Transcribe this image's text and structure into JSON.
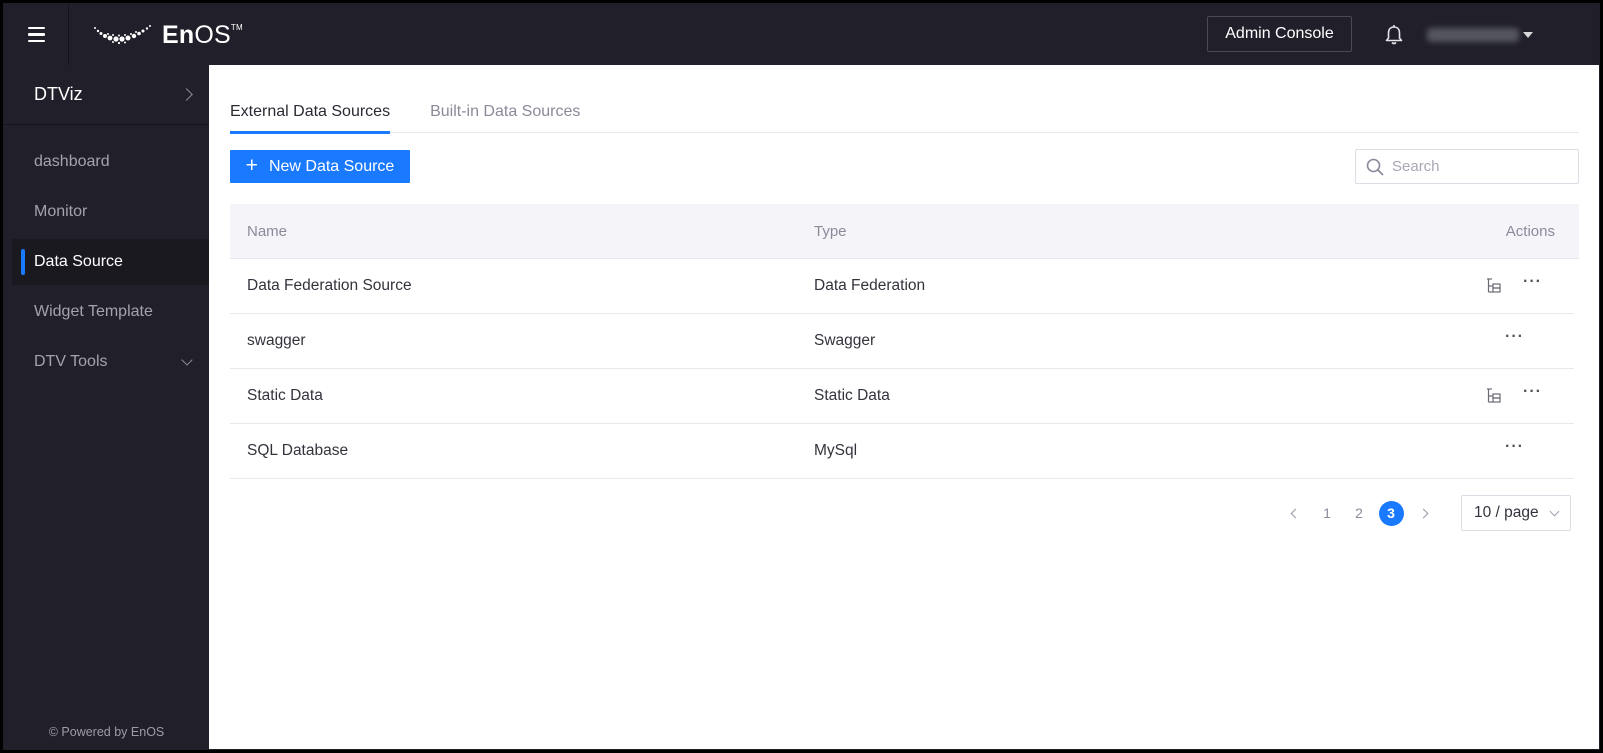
{
  "topbar": {
    "brand": "EnOS",
    "brand_bold": "En",
    "brand_light": "OS",
    "brand_tm": "TM",
    "admin_console_label": "Admin Console",
    "icons": {
      "menu": "hamburger-icon",
      "logo": "enos-logo-icon",
      "notifications": "bell-icon",
      "user_menu": "caret-down-icon"
    }
  },
  "sidebar": {
    "app_title": "DTViz",
    "items": [
      {
        "label": "dashboard",
        "active": false
      },
      {
        "label": "Monitor",
        "active": false
      },
      {
        "label": "Data Source",
        "active": true
      },
      {
        "label": "Widget Template",
        "active": false
      },
      {
        "label": "DTV Tools",
        "active": false,
        "expandable": true
      }
    ],
    "footer": "© Powered by EnOS",
    "accent_color": "#1a7aff"
  },
  "main": {
    "tabs": [
      {
        "label": "External Data Sources",
        "active": true
      },
      {
        "label": "Built-in Data Sources",
        "active": false
      }
    ],
    "new_button_label": "New Data Source",
    "search": {
      "placeholder": "Search",
      "value": ""
    },
    "table": {
      "columns": [
        "Name",
        "Type",
        "Actions"
      ],
      "rows": [
        {
          "name": "Data Federation Source",
          "type": "Data Federation",
          "has_structure_action": true
        },
        {
          "name": "swagger",
          "type": "Swagger",
          "has_structure_action": false
        },
        {
          "name": "Static Data",
          "type": "Static Data",
          "has_structure_action": true
        },
        {
          "name": "SQL Database",
          "type": "MySql",
          "has_structure_action": false
        }
      ],
      "more_label": "···"
    },
    "pagination": {
      "pages": [
        "1",
        "2",
        "3"
      ],
      "current_page": "3",
      "page_size_label": "10 / page"
    }
  }
}
